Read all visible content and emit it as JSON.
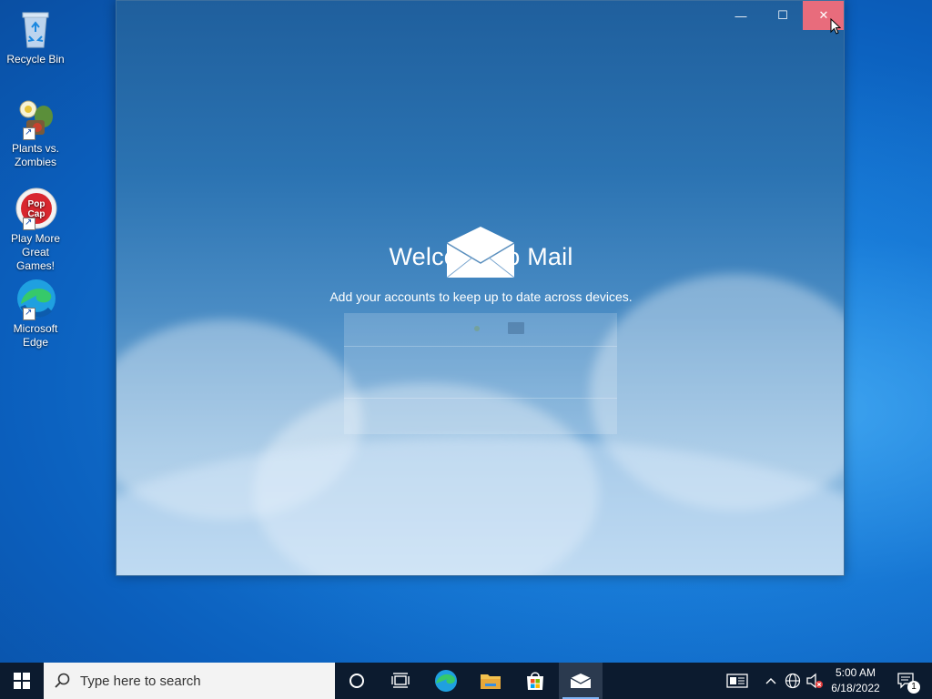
{
  "desktop": {
    "icons": [
      {
        "label": "Recycle Bin"
      },
      {
        "label": "Plants vs. Zombies"
      },
      {
        "label": "Play More Great Games!"
      },
      {
        "label": "Microsoft Edge"
      }
    ]
  },
  "mail_window": {
    "welcome_title": "Welcome to Mail",
    "welcome_subtitle": "Add your accounts to keep up to date across devices.",
    "titlebar": {
      "minimize": "—",
      "maximize": "☐",
      "close": "✕"
    }
  },
  "taskbar": {
    "search_placeholder": "Type here to search",
    "apps": [
      "cortana",
      "task-view",
      "edge",
      "file-explorer",
      "store",
      "mail"
    ],
    "active_app": "mail",
    "clock_time": "5:00 AM",
    "clock_date": "6/18/2022",
    "notification_count": "1"
  },
  "colors": {
    "accent": "#0078d7",
    "close_hover": "#e86c7c",
    "taskbar_bg": "#0c1b2f"
  }
}
